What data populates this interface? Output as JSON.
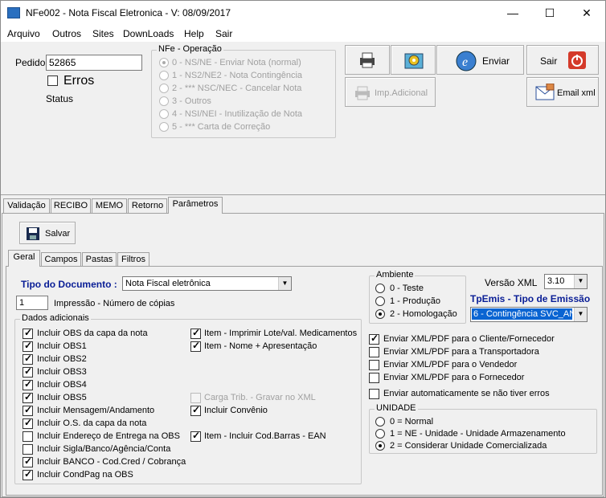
{
  "window": {
    "title": "NFe002 - Nota Fiscal Eletronica - V: 08/09/2017",
    "minimize": "—",
    "maximize": "☐",
    "close": "✕"
  },
  "menu": [
    "Arquivo",
    "Outros",
    "Sites",
    "DownLoads",
    "Help",
    "Sair"
  ],
  "pedido": {
    "label": "Pedido",
    "value": "52865"
  },
  "erros": {
    "label": "Erros",
    "checked": false
  },
  "status_label": "Status",
  "operacao": {
    "title": "NFe - Operação",
    "options": [
      "0 - NS/NE - Enviar Nota (normal)",
      "1 - NS2/NE2 - Nota Contingência",
      "2 - *** NSC/NEC - Cancelar Nota",
      "3 - Outros",
      "4 - NSI/NEI - Inutilização de Nota",
      "5 - *** Carta de Correção"
    ],
    "selected": 0
  },
  "toolbar": {
    "enviar": "Enviar",
    "sair": "Sair",
    "imp_adicional": "Imp.Adicional",
    "email_xml": "Email xml"
  },
  "tabs": [
    "Validação",
    "RECIBO",
    "MEMO",
    "Retorno",
    "Parâmetros"
  ],
  "active_tab": "Parâmetros",
  "salvar": "Salvar",
  "subtabs": [
    "Geral",
    "Campos",
    "Pastas",
    "Filtros"
  ],
  "tipo_documento": {
    "label": "Tipo do Documento :",
    "value": "Nota Fiscal eletrônica"
  },
  "impressao": {
    "value": "1",
    "label": "Impressão - Número de cópias"
  },
  "dados_adicionais": {
    "title": "Dados adicionais",
    "left": [
      {
        "label": "Incluir OBS da capa da nota",
        "checked": true
      },
      {
        "label": "Incluir OBS1",
        "checked": true
      },
      {
        "label": "Incluir OBS2",
        "checked": true
      },
      {
        "label": "Incluir OBS3",
        "checked": true
      },
      {
        "label": "Incluir OBS4",
        "checked": true
      },
      {
        "label": "Incluir OBS5",
        "checked": true
      },
      {
        "label": "Incluir Mensagem/Andamento",
        "checked": true
      },
      {
        "label": "Incluir O.S. da capa da nota",
        "checked": true
      },
      {
        "label": "Incluir Endereço de Entrega na OBS",
        "checked": false
      },
      {
        "label": "Incluir Sigla/Banco/Agência/Conta",
        "checked": false
      },
      {
        "label": "Incluir BANCO - Cod.Cred / Cobrança",
        "checked": true
      },
      {
        "label": "Incluir CondPag na OBS",
        "checked": true
      }
    ],
    "right": [
      {
        "label": "Item - Imprimir Lote/val. Medicamentos",
        "checked": true
      },
      {
        "label": "Item - Nome + Apresentação",
        "checked": true
      },
      {
        "label": "Carga Trib. - Gravar no XML",
        "checked": false,
        "disabled": true
      },
      {
        "label": "Incluir Convênio",
        "checked": true
      },
      {
        "label": "Item - Incluir Cod.Barras - EAN",
        "checked": true
      }
    ]
  },
  "ambiente": {
    "title": "Ambiente",
    "options": [
      "0 - Teste",
      "1 - Produção",
      "2 - Homologação"
    ],
    "selected": 2
  },
  "versao_xml": {
    "label": "Versão XML",
    "value": "3.10"
  },
  "tpemis": {
    "label": "TpEmis - Tipo de Emissão",
    "value": "6 - Contingência SVC_AN"
  },
  "envios": [
    {
      "label": "Enviar XML/PDF para o Cliente/Fornecedor",
      "checked": true
    },
    {
      "label": "Enviar XML/PDF para a Transportadora",
      "checked": false
    },
    {
      "label": "Enviar XML/PDF para o Vendedor",
      "checked": false
    },
    {
      "label": "Enviar XML/PDF para o Fornecedor",
      "checked": false
    },
    {
      "label": "Enviar automaticamente se não tiver erros",
      "checked": false
    }
  ],
  "unidade": {
    "title": "UNIDADE",
    "options": [
      "0 = Normal",
      "1 = NE - Unidade - Unidade Armazenamento",
      "2 = Considerar Unidade Comercializada"
    ],
    "selected": 2
  }
}
